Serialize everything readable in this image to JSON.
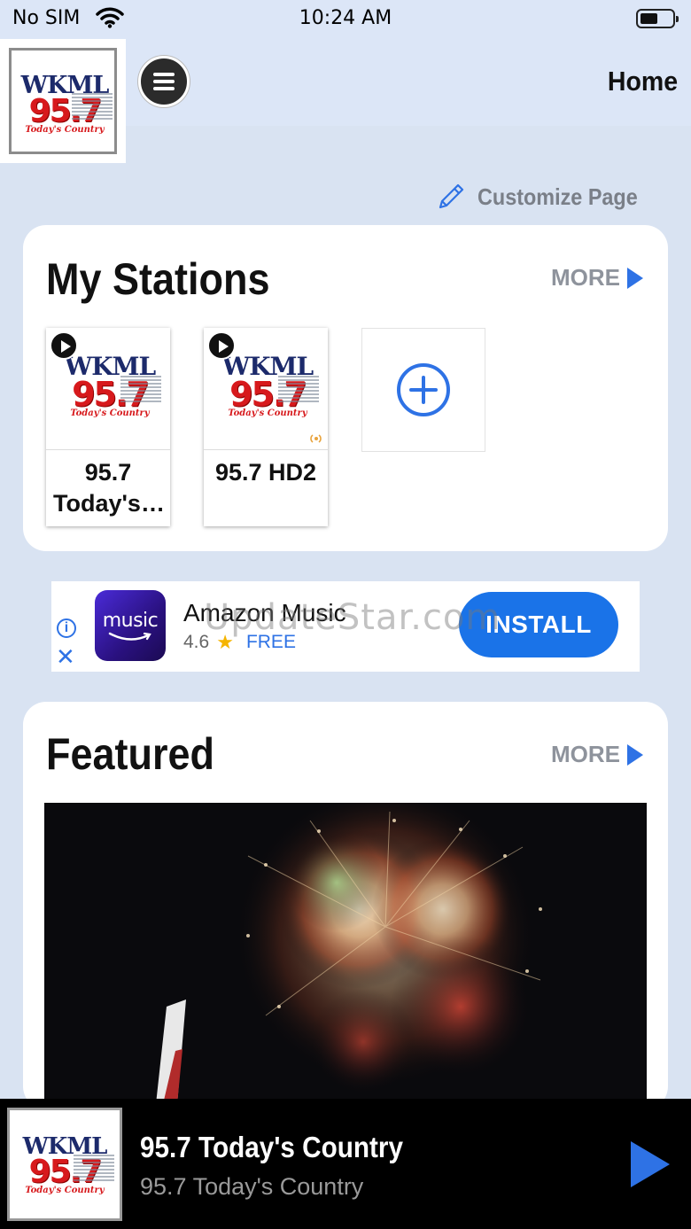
{
  "status_bar": {
    "carrier": "No SIM",
    "time": "10:24 AM"
  },
  "header": {
    "title": "Home"
  },
  "logo": {
    "call_letters": "WKML",
    "frequency": "95.7",
    "tagline": "Today's Country"
  },
  "customize": {
    "label": "Customize Page"
  },
  "my_stations": {
    "title": "My Stations",
    "more_label": "MORE",
    "items": [
      {
        "name": "95.7 Today's…"
      },
      {
        "name": "95.7 HD2"
      }
    ]
  },
  "ad": {
    "app_icon_text": "music",
    "app_name": "Amazon Music",
    "rating": "4.6",
    "price": "FREE",
    "install_label": "INSTALL",
    "info_icon": "ⓘ",
    "close_icon": "✕"
  },
  "watermark": "UpdateStar.com",
  "featured": {
    "title": "Featured",
    "more_label": "MORE"
  },
  "now_playing": {
    "title": "95.7 Today's Country",
    "subtitle": "95.7 Today's Country"
  },
  "colors": {
    "accent": "#2e72e5",
    "background": "#d9e3f2",
    "player": "#000000"
  }
}
